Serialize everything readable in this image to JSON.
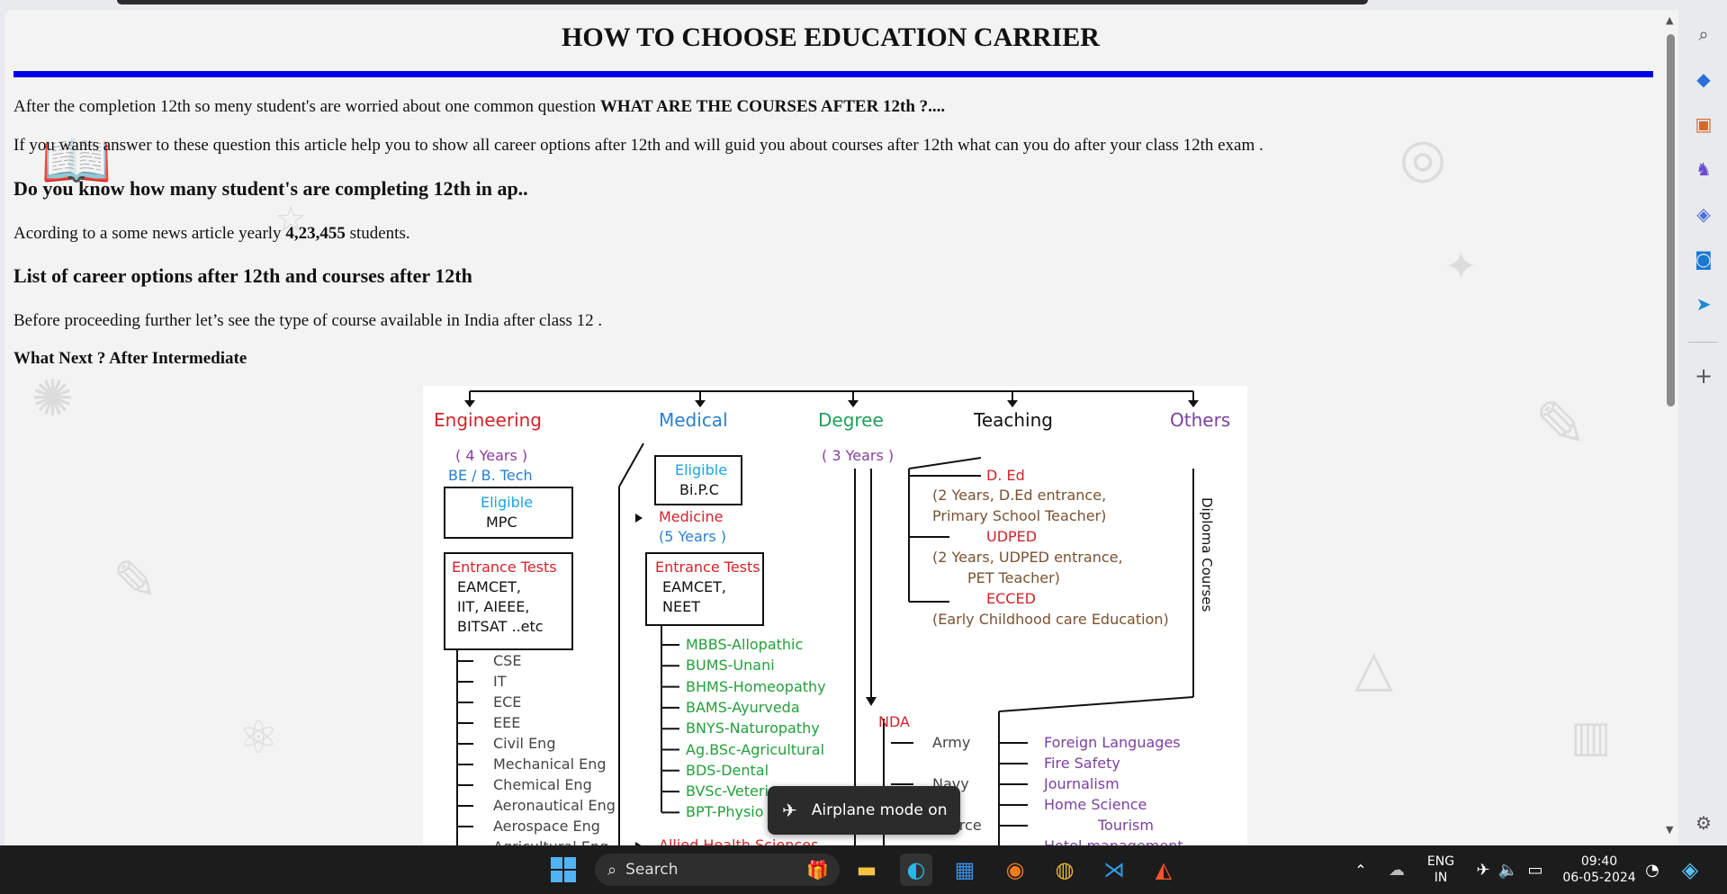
{
  "page": {
    "title": "HOW TO CHOOSE EDUCATION CARRIER",
    "p1_prefix": "After the completion 12th so meny student's are worried about one common question ",
    "p1_bold": "WHAT ARE THE COURSES AFTER 12th ?....",
    "p2": "If you wants answer to these question this article help you to show all career options after 12th and will guid you about courses after 12th what can you do after your class 12th exam .",
    "h_count": "Do you know how many student's are completing 12th in ap..",
    "p3_prefix": "Acording to a some news article yearly ",
    "p3_bold": "4,23,455",
    "p3_suffix": " students.",
    "h_list": "List of career options after 12th and courses after 12th",
    "p4": "Before proceeding further let’s see the type of course available in India after class 12 .",
    "h_next": "What Next ? After Intermediate"
  },
  "chart": {
    "branches": {
      "engineering": "Engineering",
      "medical": "Medical",
      "degree": "Degree",
      "teaching": "Teaching",
      "others": "Others"
    },
    "engineering": {
      "duration": "( 4 Years )",
      "degree": "BE / B. Tech",
      "eligible_label": "Eligible",
      "eligible_value": "MPC",
      "tests_label": "Entrance Tests",
      "tests_line1": "EAMCET,",
      "tests_line2": "IIT,   AIEEE,",
      "tests_line3": "BITSAT ..etc",
      "courses": [
        "CSE",
        "IT",
        "ECE",
        "EEE",
        "Civil Eng",
        "Mechanical Eng",
        "Chemical Eng",
        "Aeronautical Eng",
        "Aerospace Eng",
        "Agricultural Eng"
      ]
    },
    "medical": {
      "eligible_label": "Eligible",
      "eligible_value": "Bi.P.C",
      "medicine": "Medicine",
      "medicine_duration": "(5 Years )",
      "tests_label": "Entrance Tests",
      "tests_line1": "EAMCET,",
      "tests_line2": "NEET",
      "courses": [
        "MBBS-Allopathic",
        "BUMS-Unani",
        "BHMS-Homeopathy",
        "BAMS-Ayurveda",
        "BNYS-Naturopathy",
        "Ag.BSc-Agricultural",
        "BDS-Dental",
        "BVSc-Veterinary",
        "BPT-Physio"
      ],
      "allied": "Allied Health Sciences"
    },
    "degree": {
      "duration": "( 3 Years )",
      "nda": "NDA",
      "nda_items": [
        "Army",
        "Navy"
      ],
      "air_force_partial": "orce"
    },
    "teaching": {
      "ded": "D. Ed",
      "ded_detail1": "(2 Years, D.Ed entrance,",
      "ded_detail2": "Primary School Teacher)",
      "udped": "UDPED",
      "udped_detail1": "(2 Years, UDPED entrance,",
      "udped_detail2": "PET  Teacher)",
      "ecced": "ECCED",
      "ecced_detail": "(Early Childhood care Education)"
    },
    "others": {
      "diploma": "Diploma Courses",
      "courses": [
        "Foreign Languages",
        "Fire Safety",
        "Journalism",
        "Home Science",
        "Tourism",
        "Hotel management"
      ]
    },
    "colors": {
      "engineering": "#d2232a",
      "eligible": "#1aa3e0",
      "medical": "#2a7fd0",
      "degree": "#1fa05a",
      "others": "#7b3fa0",
      "green": "#23a03a",
      "red": "#d2232a",
      "brown": "#7a5230"
    }
  },
  "toast": {
    "icon": "airplane-icon",
    "text": "Airplane mode on"
  },
  "taskbar": {
    "search_placeholder": "Search",
    "language_line1": "ENG",
    "language_line2": "IN",
    "time": "09:40",
    "date": "06-05-2024"
  },
  "sidebar": {
    "icons": [
      "search-icon",
      "tag-icon",
      "briefcase-icon",
      "games-icon",
      "copilot-icon",
      "outlook-icon",
      "send-icon",
      "add-icon",
      "settings-icon"
    ]
  }
}
